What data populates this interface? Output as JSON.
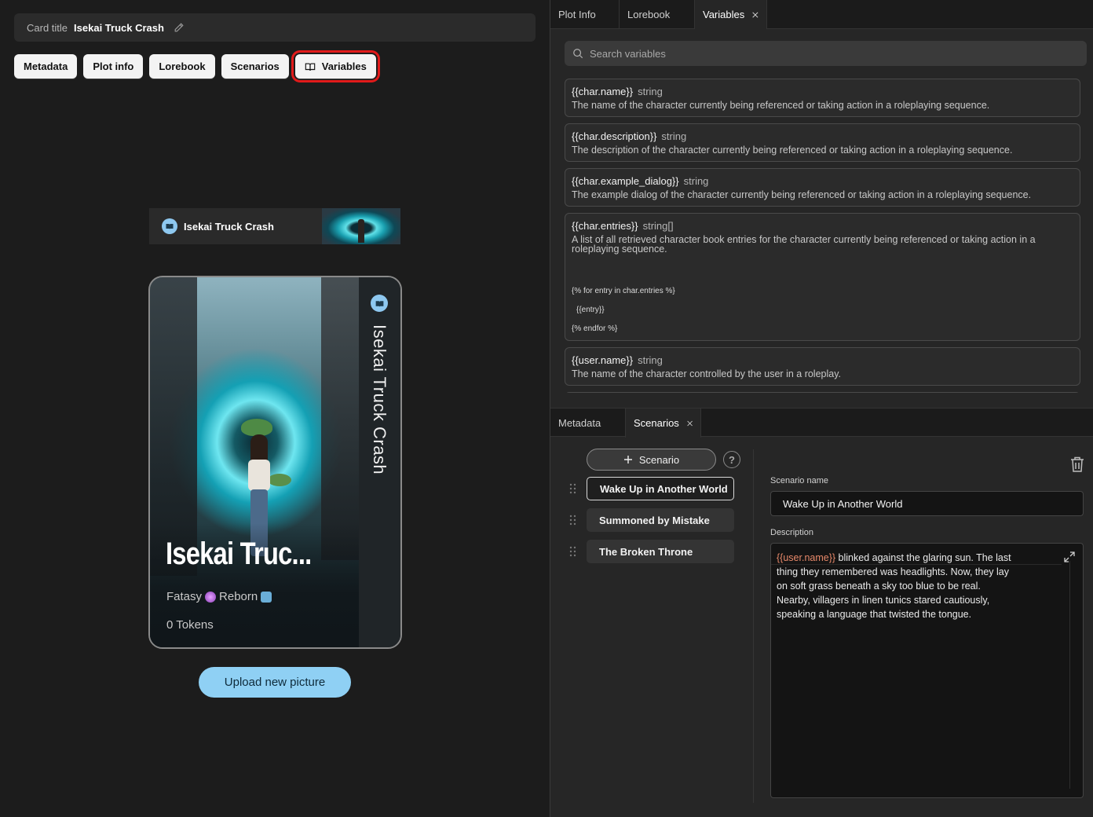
{
  "card_title_bar": {
    "label": "Card title",
    "value": "Isekai Truck Crash"
  },
  "nav_pills": [
    {
      "label": "Metadata"
    },
    {
      "label": "Plot info"
    },
    {
      "label": "Lorebook"
    },
    {
      "label": "Scenarios"
    },
    {
      "label": "Variables",
      "icon": "book-icon",
      "highlighted": true
    }
  ],
  "banner": {
    "title": "Isekai Truck Crash",
    "icon": "book-icon"
  },
  "card": {
    "vertical_title": "Isekai Truck Crash",
    "big_title": "Isekai Truc...",
    "tags": "Fatasy",
    "tag2": "Reborn",
    "tokens": "0 Tokens"
  },
  "upload_button": "Upload new picture",
  "top_tabs": [
    {
      "label": "Plot Info"
    },
    {
      "label": "Lorebook"
    },
    {
      "label": "Variables",
      "active": true,
      "closable": true
    }
  ],
  "variables": {
    "search_placeholder": "Search variables",
    "items": [
      {
        "name": "{{char.name}}",
        "type": "string",
        "desc": "The name of the character currently being referenced or taking action in a roleplaying sequence."
      },
      {
        "name": "{{char.description}}",
        "type": "string",
        "desc": "The description of the character currently being referenced or taking action in a roleplaying sequence."
      },
      {
        "name": "{{char.example_dialog}}",
        "type": "string",
        "desc": "The example dialog of the character currently being referenced or taking action in a roleplaying sequence."
      },
      {
        "name": "{{char.entries}}",
        "type": "string[]",
        "desc": "A list of all retrieved character book entries for the character currently being referenced or taking action in a roleplaying sequence.",
        "code": [
          "{% for entry in char.entries %}",
          "{{entry}}",
          "{% endfor %}"
        ]
      },
      {
        "name": "{{user.name}}",
        "type": "string",
        "desc": "The name of the character controlled by the user in a roleplay."
      }
    ]
  },
  "bottom_tabs": [
    {
      "label": "Metadata"
    },
    {
      "label": "Scenarios",
      "active": true,
      "closable": true
    }
  ],
  "scenarios": {
    "add_label": "Scenario",
    "help": "?",
    "items": [
      {
        "label": "Wake Up in Another World",
        "selected": true
      },
      {
        "label": "Summoned by Mistake"
      },
      {
        "label": "The Broken Throne"
      }
    ],
    "name_label": "Scenario name",
    "name_value": "Wake Up in Another World",
    "desc_label": "Description",
    "desc_var": "{{user.name}}",
    "desc_text": " blinked against the glaring sun. The last thing they remembered was headlights. Now, they lay on soft grass beneath a sky too blue to be real. Nearby, villagers in linen tunics stared cautiously, speaking a language that twisted the tongue."
  },
  "colors": {
    "accent": "#8fd0f4",
    "highlight": "#e11a1a",
    "var_text": "#e8896a"
  }
}
